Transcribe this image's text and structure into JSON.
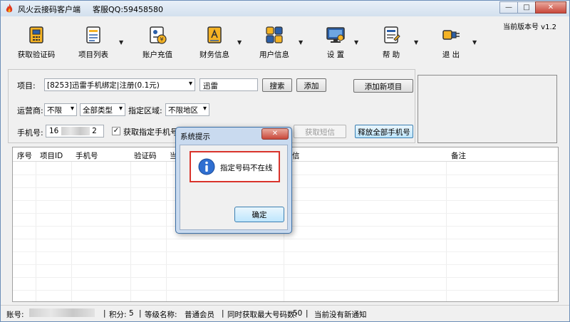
{
  "window": {
    "title": "风火云接码客户端",
    "service_qq": "客服QQ:59458580",
    "controls": {
      "minimize": "—",
      "maximize": "□",
      "close": "✕"
    }
  },
  "version_label": "当前版本号 v1.2",
  "toolbar": {
    "items": [
      {
        "label": "获取验证码",
        "icon": "sim-card-icon",
        "dropdown": false
      },
      {
        "label": "项目列表",
        "icon": "list-document-icon",
        "dropdown": true
      },
      {
        "label": "账户充值",
        "icon": "account-recharge-icon",
        "dropdown": false
      },
      {
        "label": "财务信息",
        "icon": "finance-document-icon",
        "dropdown": true
      },
      {
        "label": "用户信息",
        "icon": "users-icon",
        "dropdown": true
      },
      {
        "label": "设 置",
        "icon": "monitor-settings-icon",
        "dropdown": true
      },
      {
        "label": "帮 助",
        "icon": "help-document-icon",
        "dropdown": true
      },
      {
        "label": "退 出",
        "icon": "exit-plug-icon",
        "dropdown": true
      }
    ]
  },
  "form": {
    "project_label": "项目:",
    "project_select": "[8253]迅雷手机绑定|注册(0.1元)",
    "project_input": "迅雷",
    "search_btn": "搜索",
    "add_btn": "添加",
    "add_new_project_btn": "添加新项目",
    "carrier_label": "运营商:",
    "carrier_select": "不限",
    "type_select": "全部类型",
    "region_label": "指定区域:",
    "region_select": "不限地区",
    "phone_label": "手机号:",
    "phone_prefix": "16",
    "phone_suffix": "2",
    "get_specific_label": "获取指定手机号",
    "get_specific_checked": "✓",
    "get_sms_btn": "获取短信",
    "release_all_btn": "释放全部手机号"
  },
  "table": {
    "columns": [
      "序号",
      "项目ID",
      "手机号",
      "验证码",
      "当",
      "信",
      "备注"
    ]
  },
  "status": {
    "account_label": "账号:",
    "points_label": "积分:",
    "points_value": "5",
    "level_label": "等级名称:",
    "level_value": "普通会员",
    "max_label": "同时获取最大号码数:",
    "max_value": "50",
    "notice": "当前没有新通知",
    "sep": "|"
  },
  "dialog": {
    "title": "系统提示",
    "close": "✕",
    "message": "指定号码不在线",
    "ok": "确定"
  }
}
